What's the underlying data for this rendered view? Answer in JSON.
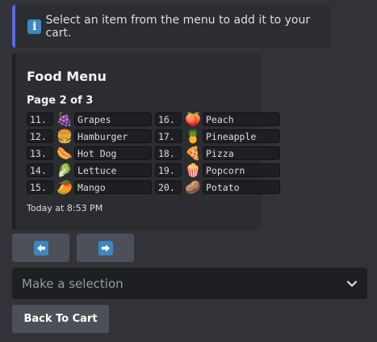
{
  "info": {
    "icon": "info-icon",
    "icon_glyph": "i",
    "text": "Select an item from the menu to add it to your cart."
  },
  "embed": {
    "title": "Food Menu",
    "page_label": "Page 2 of 3",
    "timestamp": "Today at 8:53 PM",
    "items": [
      {
        "num": "11.",
        "emoji": "🍇",
        "name": "Grapes"
      },
      {
        "num": "12.",
        "emoji": "🍔",
        "name": "Hamburger"
      },
      {
        "num": "13.",
        "emoji": "🌭",
        "name": "Hot Dog"
      },
      {
        "num": "14.",
        "emoji": "🥬",
        "name": "Lettuce"
      },
      {
        "num": "15.",
        "emoji": "🥭",
        "name": "Mango"
      },
      {
        "num": "16.",
        "emoji": "🍑",
        "name": "Peach"
      },
      {
        "num": "17.",
        "emoji": "🍍",
        "name": "Pineapple"
      },
      {
        "num": "18.",
        "emoji": "🍕",
        "name": "Pizza"
      },
      {
        "num": "19.",
        "emoji": "🍿",
        "name": "Popcorn"
      },
      {
        "num": "20.",
        "emoji": "🥔",
        "name": "Potato"
      }
    ]
  },
  "buttons": {
    "prev_icon": "arrow-left-icon",
    "next_icon": "arrow-right-icon",
    "back_label": "Back To Cart"
  },
  "select": {
    "placeholder": "Make a selection",
    "icon": "chevron-down-icon"
  },
  "colors": {
    "background": "#323339",
    "accent": "#5865f2",
    "button": "#4e5058",
    "icon_blue": "#3b88c3"
  }
}
